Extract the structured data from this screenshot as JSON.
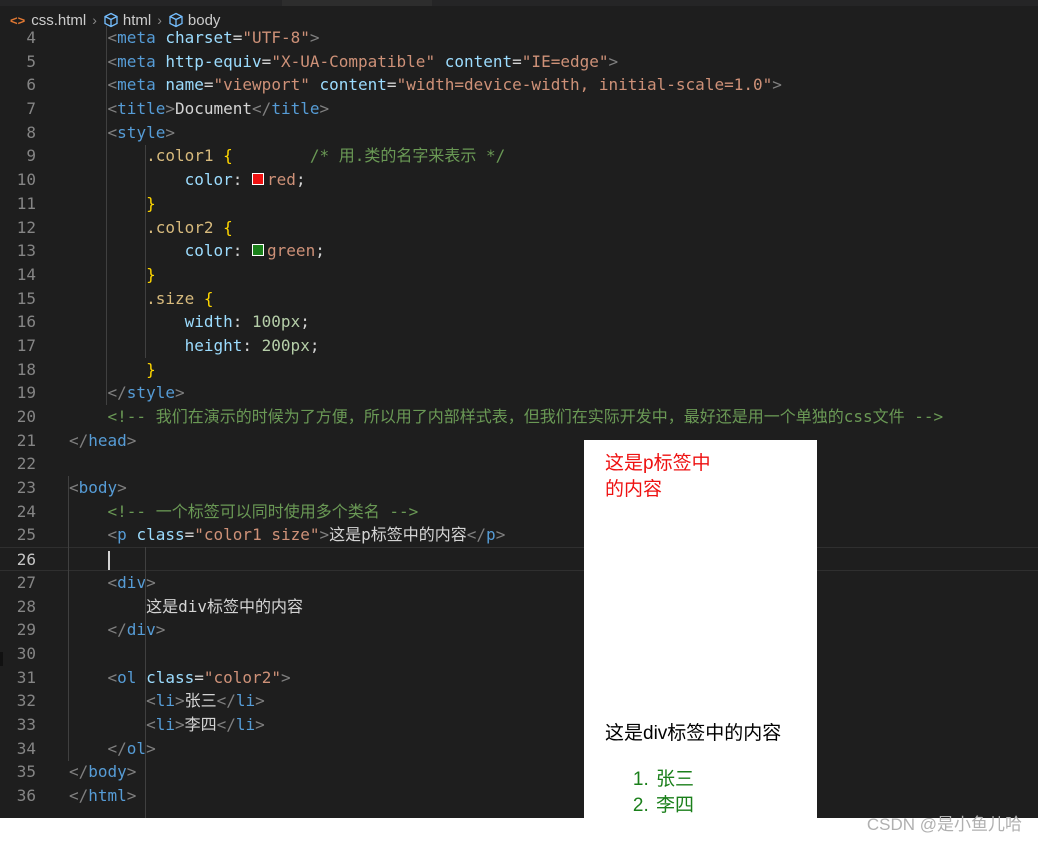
{
  "breadcrumb": {
    "file": "css.html",
    "items": [
      "html",
      "body"
    ]
  },
  "editor": {
    "current_line": 26,
    "lines": [
      {
        "n": "4",
        "tokens": [
          [
            "ind",
            "      "
          ],
          [
            "bracket",
            "<"
          ],
          [
            "tag",
            "meta"
          ],
          [
            "text",
            " "
          ],
          [
            "attr",
            "charset"
          ],
          [
            "text",
            "="
          ],
          [
            "str",
            "\"UTF-8\""
          ],
          [
            "bracket",
            ">"
          ]
        ]
      },
      {
        "n": "5",
        "tokens": [
          [
            "ind",
            "      "
          ],
          [
            "bracket",
            "<"
          ],
          [
            "tag",
            "meta"
          ],
          [
            "text",
            " "
          ],
          [
            "attr",
            "http-equiv"
          ],
          [
            "text",
            "="
          ],
          [
            "str",
            "\"X-UA-Compatible\""
          ],
          [
            "text",
            " "
          ],
          [
            "attr",
            "content"
          ],
          [
            "text",
            "="
          ],
          [
            "str",
            "\"IE=edge\""
          ],
          [
            "bracket",
            ">"
          ]
        ]
      },
      {
        "n": "6",
        "tokens": [
          [
            "ind",
            "      "
          ],
          [
            "bracket",
            "<"
          ],
          [
            "tag",
            "meta"
          ],
          [
            "text",
            " "
          ],
          [
            "attr",
            "name"
          ],
          [
            "text",
            "="
          ],
          [
            "str",
            "\"viewport\""
          ],
          [
            "text",
            " "
          ],
          [
            "attr",
            "content"
          ],
          [
            "text",
            "="
          ],
          [
            "str",
            "\"width=device-width, initial-scale=1.0\""
          ],
          [
            "bracket",
            ">"
          ]
        ]
      },
      {
        "n": "7",
        "tokens": [
          [
            "ind",
            "      "
          ],
          [
            "bracket",
            "<"
          ],
          [
            "tag",
            "title"
          ],
          [
            "bracket",
            ">"
          ],
          [
            "text",
            "Document"
          ],
          [
            "bracket",
            "</"
          ],
          [
            "tag",
            "title"
          ],
          [
            "bracket",
            ">"
          ]
        ]
      },
      {
        "n": "8",
        "tokens": [
          [
            "ind",
            "      "
          ],
          [
            "bracket",
            "<"
          ],
          [
            "tag",
            "style"
          ],
          [
            "bracket",
            ">"
          ]
        ]
      },
      {
        "n": "9",
        "tokens": [
          [
            "ind",
            "          "
          ],
          [
            "sel",
            ".color1"
          ],
          [
            "text",
            " "
          ],
          [
            "brace",
            "{"
          ],
          [
            "text",
            "        "
          ],
          [
            "com",
            "/* 用.类的名字来表示 */"
          ]
        ]
      },
      {
        "n": "10",
        "tokens": [
          [
            "ind",
            "              "
          ],
          [
            "prop",
            "color"
          ],
          [
            "text",
            ": "
          ],
          [
            "swatch",
            "#ee1111"
          ],
          [
            "str",
            "red"
          ],
          [
            "text",
            ";"
          ]
        ]
      },
      {
        "n": "11",
        "tokens": [
          [
            "ind",
            "          "
          ],
          [
            "brace",
            "}"
          ]
        ]
      },
      {
        "n": "12",
        "tokens": [
          [
            "ind",
            "          "
          ],
          [
            "sel",
            ".color2"
          ],
          [
            "text",
            " "
          ],
          [
            "brace",
            "{"
          ]
        ]
      },
      {
        "n": "13",
        "tokens": [
          [
            "ind",
            "              "
          ],
          [
            "prop",
            "color"
          ],
          [
            "text",
            ": "
          ],
          [
            "swatch",
            "#1a7f1a"
          ],
          [
            "str",
            "green"
          ],
          [
            "text",
            ";"
          ]
        ]
      },
      {
        "n": "14",
        "tokens": [
          [
            "ind",
            "          "
          ],
          [
            "brace",
            "}"
          ]
        ]
      },
      {
        "n": "15",
        "tokens": [
          [
            "ind",
            "          "
          ],
          [
            "sel",
            ".size"
          ],
          [
            "text",
            " "
          ],
          [
            "brace",
            "{"
          ]
        ]
      },
      {
        "n": "16",
        "tokens": [
          [
            "ind",
            "              "
          ],
          [
            "prop",
            "width"
          ],
          [
            "text",
            ": "
          ],
          [
            "num",
            "100px"
          ],
          [
            "text",
            ";"
          ]
        ]
      },
      {
        "n": "17",
        "tokens": [
          [
            "ind",
            "              "
          ],
          [
            "prop",
            "height"
          ],
          [
            "text",
            ": "
          ],
          [
            "num",
            "200px"
          ],
          [
            "text",
            ";"
          ]
        ]
      },
      {
        "n": "18",
        "tokens": [
          [
            "ind",
            "          "
          ],
          [
            "brace",
            "}"
          ]
        ]
      },
      {
        "n": "19",
        "tokens": [
          [
            "ind",
            "      "
          ],
          [
            "bracket",
            "</"
          ],
          [
            "tag",
            "style"
          ],
          [
            "bracket",
            ">"
          ]
        ]
      },
      {
        "n": "20",
        "tokens": [
          [
            "ind",
            "      "
          ],
          [
            "com",
            "<!-- 我们在演示的时候为了方便，所以用了内部样式表，但我们在实际开发中，最好还是用一个单独的css文件 -->"
          ]
        ]
      },
      {
        "n": "21",
        "tokens": [
          [
            "ind",
            "  "
          ],
          [
            "bracket",
            "</"
          ],
          [
            "tag",
            "head"
          ],
          [
            "bracket",
            ">"
          ]
        ]
      },
      {
        "n": "22",
        "tokens": []
      },
      {
        "n": "23",
        "tokens": [
          [
            "ind",
            "  "
          ],
          [
            "bracket",
            "<"
          ],
          [
            "tag",
            "body"
          ],
          [
            "bracket",
            ">"
          ]
        ]
      },
      {
        "n": "24",
        "tokens": [
          [
            "ind",
            "      "
          ],
          [
            "com",
            "<!-- 一个标签可以同时使用多个类名 -->"
          ]
        ]
      },
      {
        "n": "25",
        "tokens": [
          [
            "ind",
            "      "
          ],
          [
            "bracket",
            "<"
          ],
          [
            "tag",
            "p"
          ],
          [
            "text",
            " "
          ],
          [
            "attr",
            "class"
          ],
          [
            "text",
            "="
          ],
          [
            "str",
            "\"color1 size\""
          ],
          [
            "bracket",
            ">"
          ],
          [
            "text",
            "这是p标签中的内容"
          ],
          [
            "bracket",
            "</"
          ],
          [
            "tag",
            "p"
          ],
          [
            "bracket",
            ">"
          ]
        ]
      },
      {
        "n": "26",
        "tokens": [
          [
            "ind",
            "      "
          ],
          [
            "cursor",
            ""
          ]
        ]
      },
      {
        "n": "27",
        "tokens": [
          [
            "ind",
            "      "
          ],
          [
            "bracket",
            "<"
          ],
          [
            "tag",
            "div"
          ],
          [
            "bracket",
            ">"
          ]
        ]
      },
      {
        "n": "28",
        "tokens": [
          [
            "ind",
            "          "
          ],
          [
            "text",
            "这是div标签中的内容"
          ]
        ]
      },
      {
        "n": "29",
        "tokens": [
          [
            "ind",
            "      "
          ],
          [
            "bracket",
            "</"
          ],
          [
            "tag",
            "div"
          ],
          [
            "bracket",
            ">"
          ]
        ]
      },
      {
        "n": "30",
        "tokens": []
      },
      {
        "n": "31",
        "tokens": [
          [
            "ind",
            "      "
          ],
          [
            "bracket",
            "<"
          ],
          [
            "tag",
            "ol"
          ],
          [
            "text",
            " "
          ],
          [
            "attr",
            "class"
          ],
          [
            "text",
            "="
          ],
          [
            "str",
            "\"color2\""
          ],
          [
            "bracket",
            ">"
          ]
        ]
      },
      {
        "n": "32",
        "tokens": [
          [
            "ind",
            "          "
          ],
          [
            "bracket",
            "<"
          ],
          [
            "tag",
            "li"
          ],
          [
            "bracket",
            ">"
          ],
          [
            "text",
            "张三"
          ],
          [
            "bracket",
            "</"
          ],
          [
            "tag",
            "li"
          ],
          [
            "bracket",
            ">"
          ]
        ]
      },
      {
        "n": "33",
        "tokens": [
          [
            "ind",
            "          "
          ],
          [
            "bracket",
            "<"
          ],
          [
            "tag",
            "li"
          ],
          [
            "bracket",
            ">"
          ],
          [
            "text",
            "李四"
          ],
          [
            "bracket",
            "</"
          ],
          [
            "tag",
            "li"
          ],
          [
            "bracket",
            ">"
          ]
        ]
      },
      {
        "n": "34",
        "tokens": [
          [
            "ind",
            "      "
          ],
          [
            "bracket",
            "</"
          ],
          [
            "tag",
            "ol"
          ],
          [
            "bracket",
            ">"
          ]
        ]
      },
      {
        "n": "35",
        "tokens": [
          [
            "ind",
            "  "
          ],
          [
            "bracket",
            "</"
          ],
          [
            "tag",
            "body"
          ],
          [
            "bracket",
            ">"
          ]
        ]
      },
      {
        "n": "36",
        "tokens": [
          [
            "ind",
            "  "
          ],
          [
            "bracket",
            "</"
          ],
          [
            "tag",
            "html"
          ],
          [
            "bracket",
            ">"
          ]
        ]
      }
    ]
  },
  "preview": {
    "p_text": "这是p标签中的内容",
    "div_text": "这是div标签中的内容",
    "list_items": [
      "张三",
      "李四"
    ],
    "colors": {
      "p": "#ee1111",
      "list": "#1a7f1a"
    }
  },
  "watermark": "CSDN @是小鱼儿哈"
}
